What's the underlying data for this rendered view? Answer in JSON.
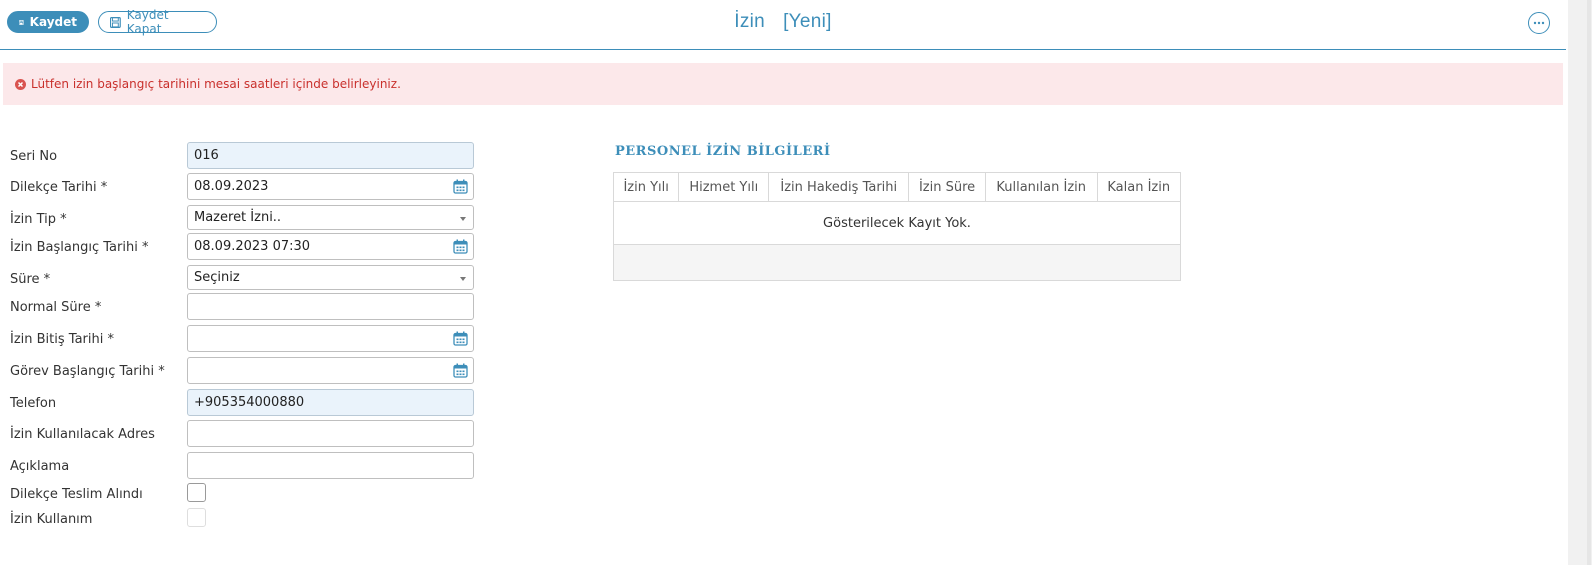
{
  "toolbar": {
    "save_label": "Kaydet",
    "save_close_label": "Kaydet Kapat",
    "title": "İzin",
    "title_status": "[Yeni]"
  },
  "alert": {
    "message": "Lütfen izin başlangıç tarihini mesai saatleri içinde belirleyiniz."
  },
  "form": {
    "seri_no": {
      "label": "Seri No",
      "value": "016"
    },
    "dilekce_tarihi": {
      "label": "Dilekçe Tarihi *",
      "value": "08.09.2023"
    },
    "izin_tip": {
      "label": "İzin Tip *",
      "value": "Mazeret İzni.."
    },
    "izin_baslangic": {
      "label": "İzin Başlangıç Tarihi *",
      "value": "08.09.2023 07:30"
    },
    "sure": {
      "label": "Süre *",
      "value": "Seçiniz"
    },
    "normal_sure": {
      "label": "Normal Süre *",
      "value": ""
    },
    "izin_bitis": {
      "label": "İzin Bitiş Tarihi *",
      "value": ""
    },
    "gorev_baslangic": {
      "label": "Görev Başlangıç Tarihi *",
      "value": ""
    },
    "telefon": {
      "label": "Telefon",
      "value": "+905354000880"
    },
    "adres": {
      "label": "İzin Kullanılacak Adres",
      "value": ""
    },
    "aciklama": {
      "label": "Açıklama",
      "value": ""
    },
    "teslim_alindi": {
      "label": "Dilekçe Teslim Alındı",
      "checked": false
    },
    "izin_kullanim": {
      "label": "İzin Kullanım",
      "checked": false,
      "disabled": true
    }
  },
  "personel": {
    "title": "PERSONEL İZİN BİLGİLERİ",
    "columns": [
      "İzin Yılı",
      "Hizmet Yılı",
      "İzin Hakediş Tarihi",
      "İzin Süre",
      "Kullanılan İzin",
      "Kalan İzin"
    ],
    "empty_text": "Gösterilecek Kayıt Yok."
  },
  "colors": {
    "accent": "#3d8eb9",
    "alert_bg": "#fce8ea",
    "alert_text": "#c9302c",
    "readonly_bg": "#eaf3fb"
  }
}
